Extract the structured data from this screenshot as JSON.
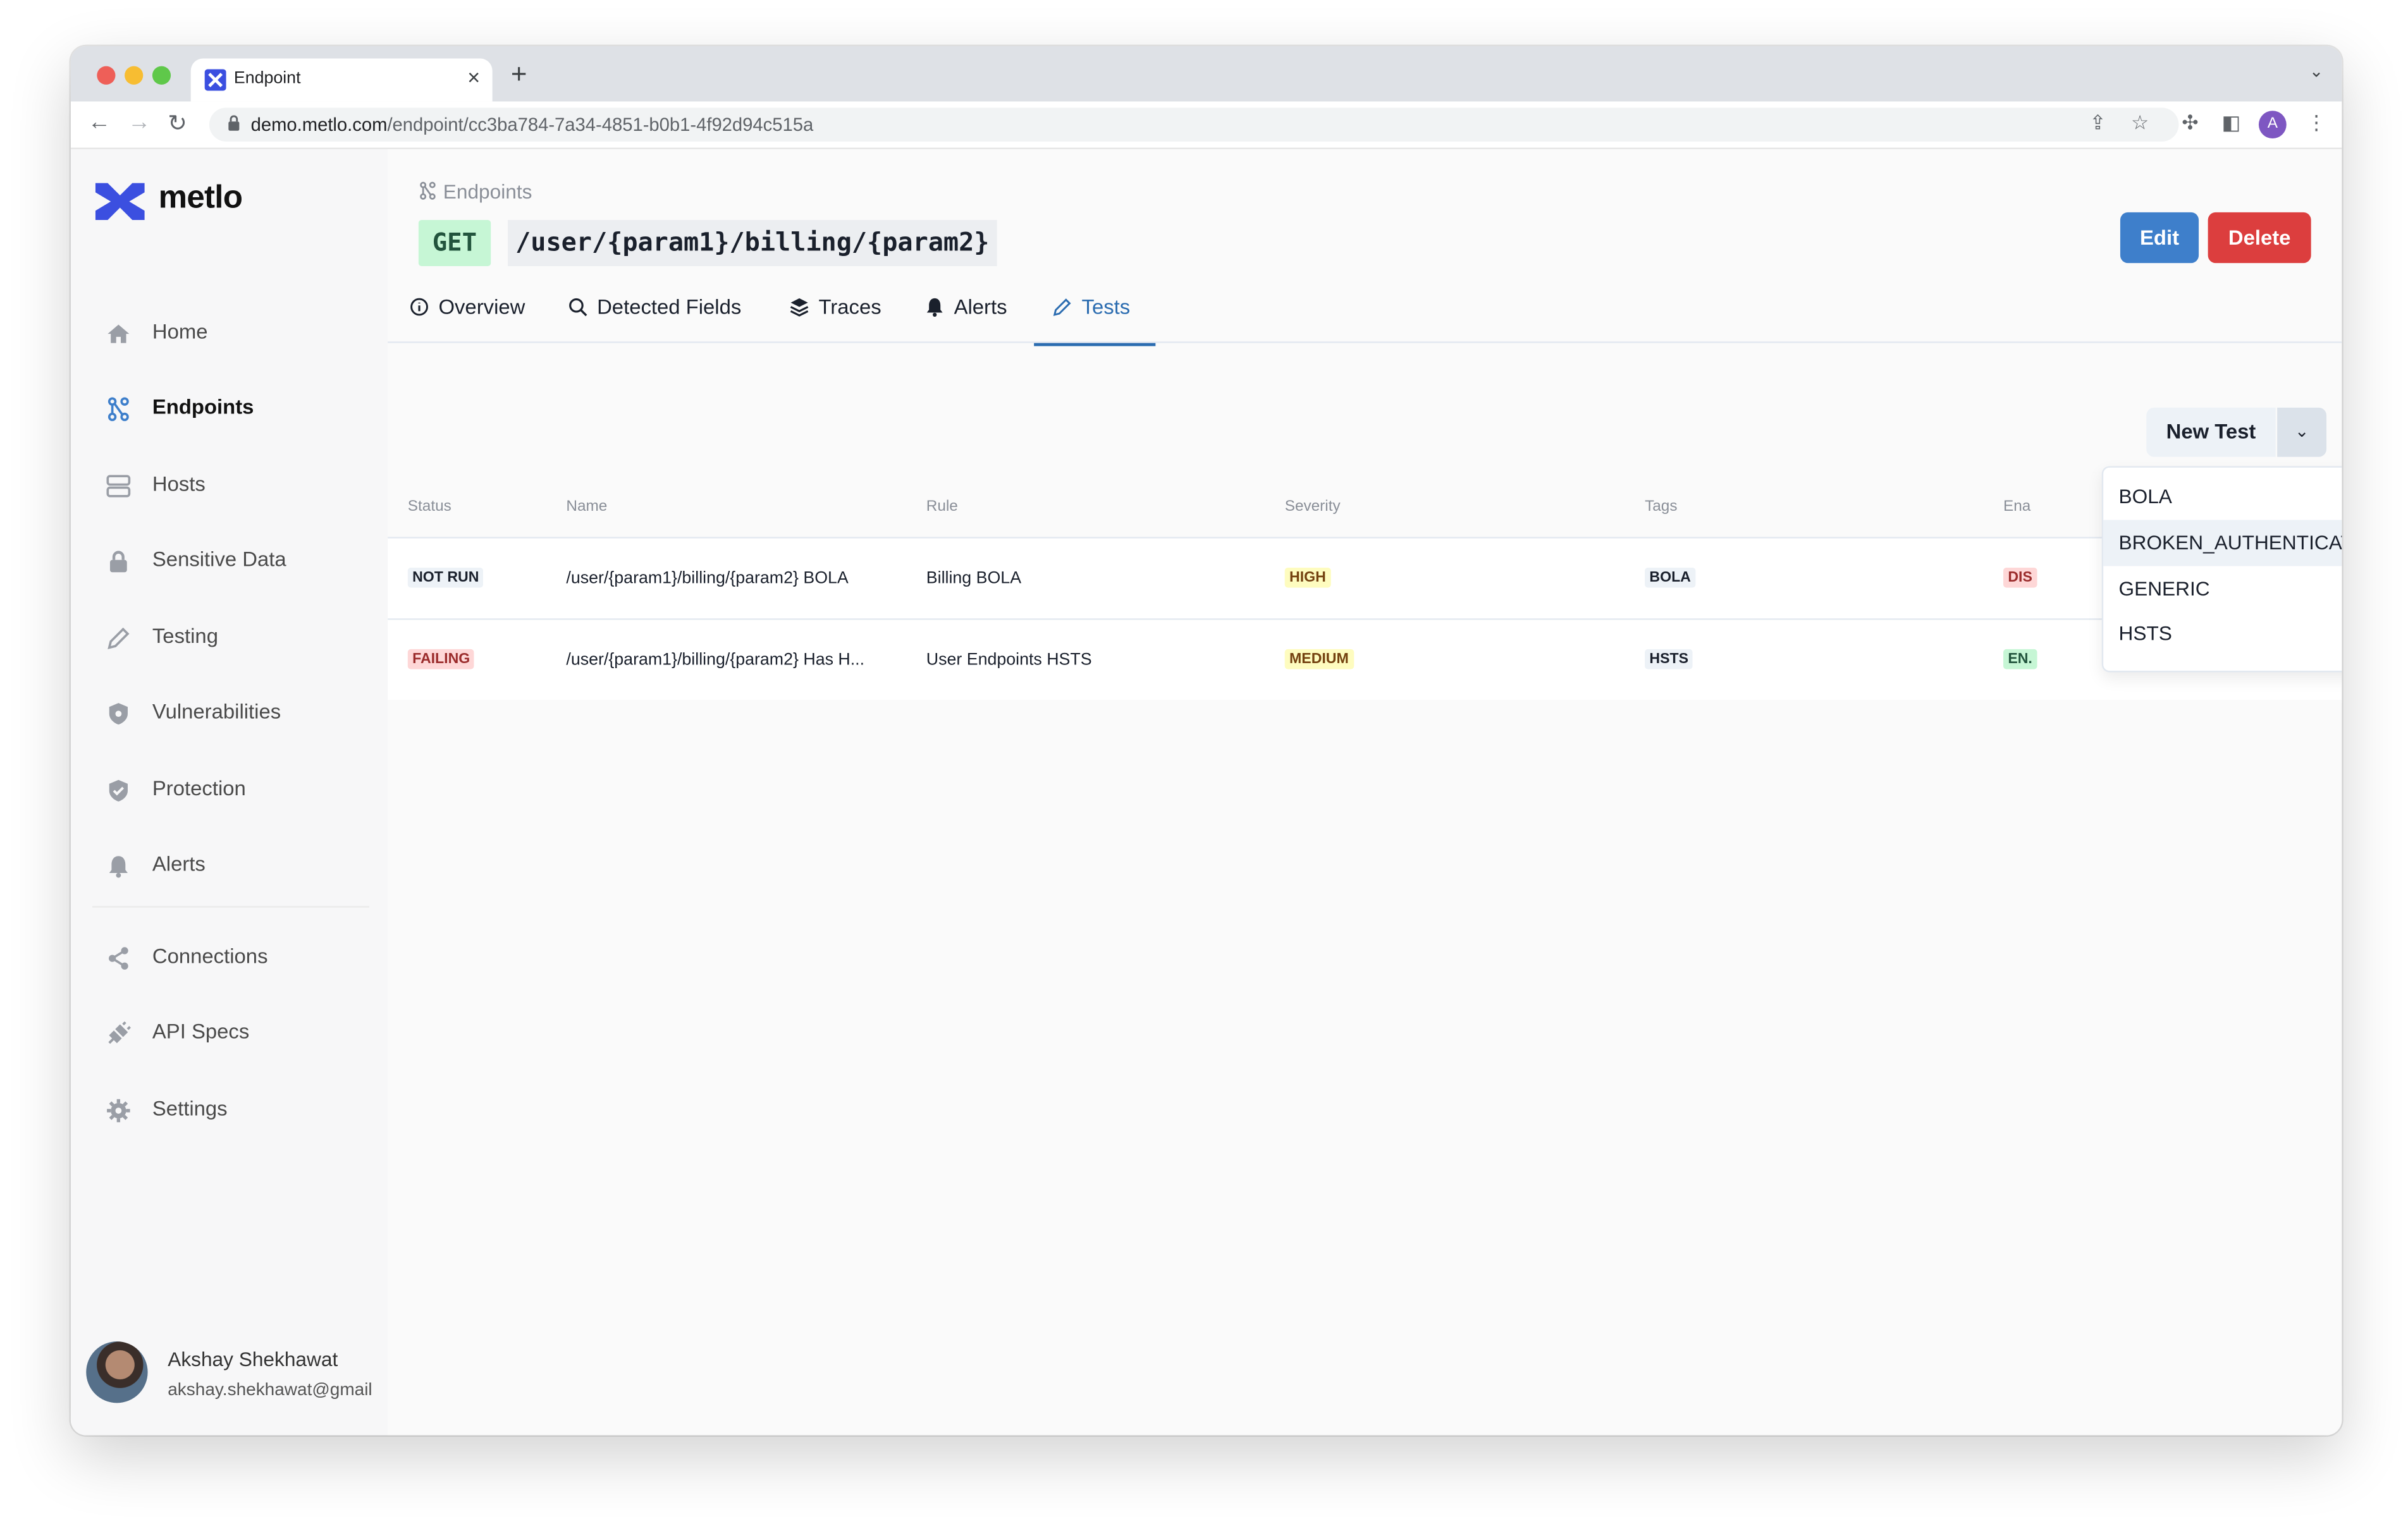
{
  "browser": {
    "tab_title": "Endpoint",
    "url_host": "demo.metlo.com",
    "url_path": "/endpoint/cc3ba784-7a34-4851-b0b1-4f92d94c515a",
    "profile_initial": "A"
  },
  "sidebar": {
    "brand": "metlo",
    "items": [
      {
        "label": "Home",
        "icon": "home-icon"
      },
      {
        "label": "Endpoints",
        "icon": "endpoints-icon",
        "active": true
      },
      {
        "label": "Hosts",
        "icon": "server-icon"
      },
      {
        "label": "Sensitive Data",
        "icon": "lock-icon"
      },
      {
        "label": "Testing",
        "icon": "pencil-icon"
      },
      {
        "label": "Vulnerabilities",
        "icon": "shield-bug-icon"
      },
      {
        "label": "Protection",
        "icon": "shield-check-icon"
      },
      {
        "label": "Alerts",
        "icon": "bell-icon"
      },
      {
        "label": "Connections",
        "icon": "share-icon"
      },
      {
        "label": "API Specs",
        "icon": "plug-icon"
      },
      {
        "label": "Settings",
        "icon": "gear-icon"
      }
    ],
    "user": {
      "name": "Akshay Shekhawat",
      "email": "akshay.shekhawat@gmail"
    }
  },
  "header": {
    "breadcrumb": "Endpoints",
    "method": "GET",
    "path": "/user/{param1}/billing/{param2}",
    "edit_label": "Edit",
    "delete_label": "Delete"
  },
  "tabs": [
    {
      "label": "Overview",
      "icon": "info-icon"
    },
    {
      "label": "Detected Fields",
      "icon": "search-icon"
    },
    {
      "label": "Traces",
      "icon": "layers-icon"
    },
    {
      "label": "Alerts",
      "icon": "bell-icon"
    },
    {
      "label": "Tests",
      "icon": "pencil-icon",
      "active": true
    }
  ],
  "new_test": {
    "label": "New Test",
    "options": [
      "BOLA",
      "BROKEN_AUTHENTICATION",
      "GENERIC",
      "HSTS"
    ],
    "highlighted": "BROKEN_AUTHENTICATION"
  },
  "table": {
    "columns": [
      "Status",
      "Name",
      "Rule",
      "Severity",
      "Tags",
      "Ena"
    ],
    "rows": [
      {
        "status": "NOT RUN",
        "name": "/user/{param1}/billing/{param2} BOLA",
        "rule": "Billing BOLA",
        "severity": "HIGH",
        "tags": "BOLA",
        "enabled": "DIS"
      },
      {
        "status": "FAILING",
        "name": "/user/{param1}/billing/{param2} Has H...",
        "rule": "User Endpoints HSTS",
        "severity": "MEDIUM",
        "tags": "HSTS",
        "enabled": "EN."
      }
    ]
  },
  "colors": {
    "accent": "#2b6cb0",
    "edit": "#3e7fcb",
    "delete": "#dc3e3e",
    "brand": "#3b4fe0"
  }
}
